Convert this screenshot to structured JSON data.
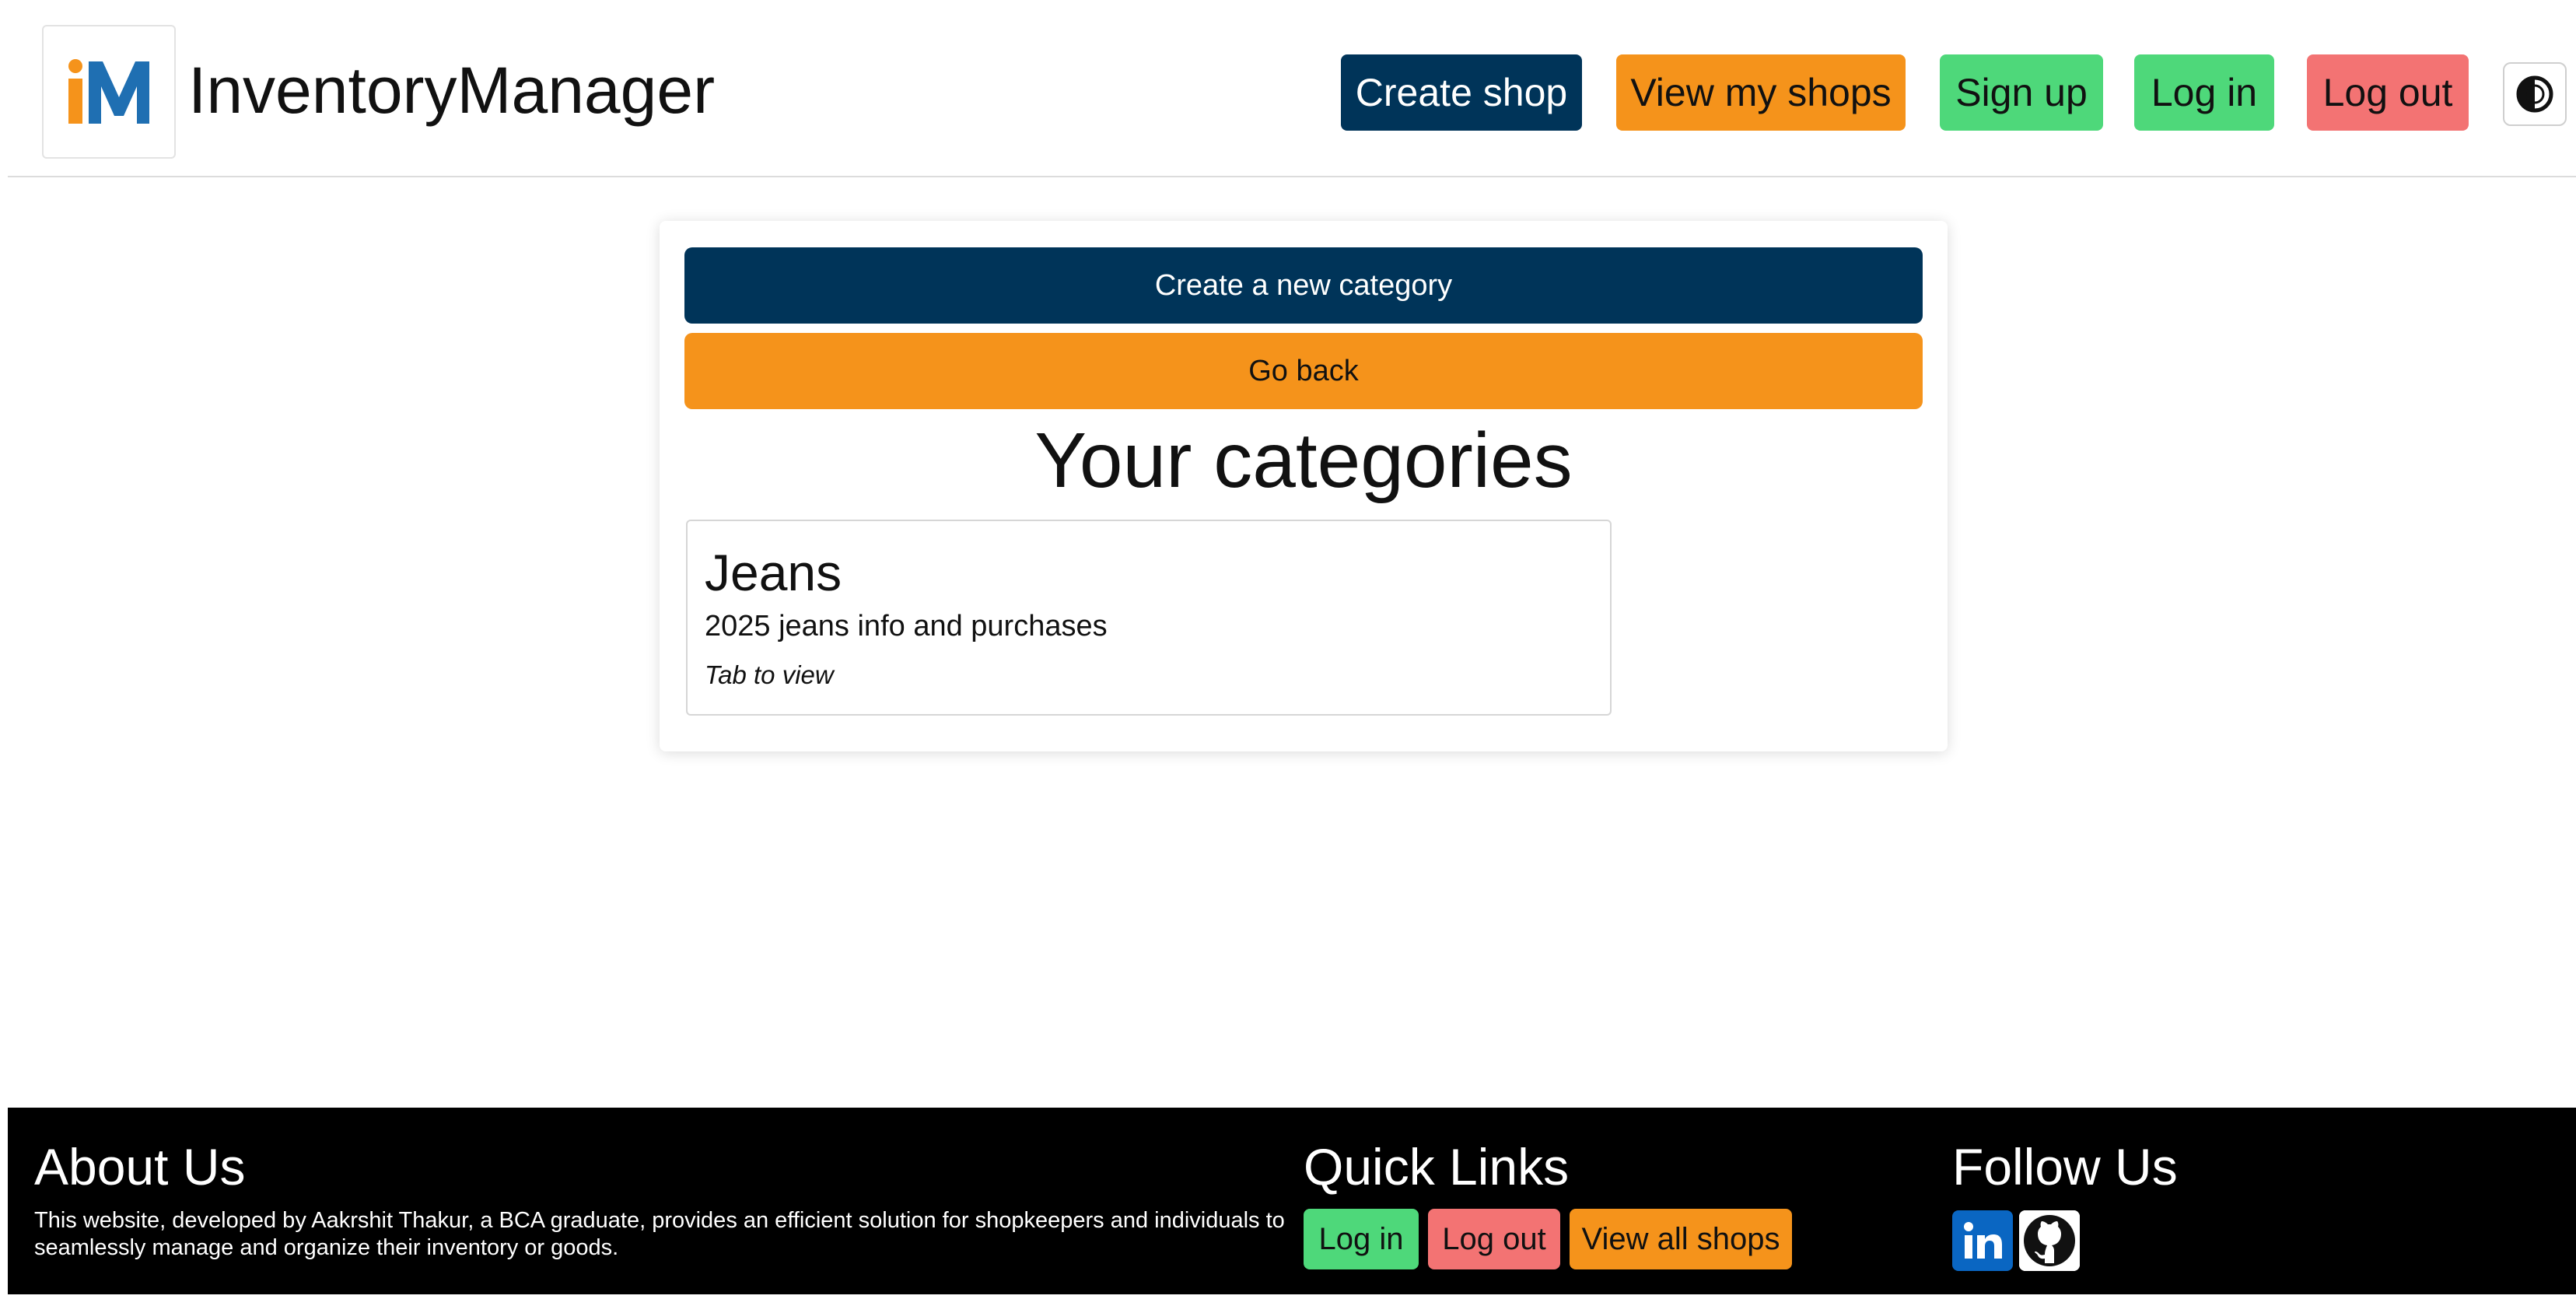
{
  "header": {
    "brand": "InventoryManager",
    "nav": {
      "create_shop": "Create shop",
      "view_my_shops": "View my shops",
      "sign_up": "Sign up",
      "log_in": "Log in",
      "log_out": "Log out"
    }
  },
  "main": {
    "create_category_label": "Create a new category",
    "go_back_label": "Go back",
    "title": "Your categories",
    "categories": [
      {
        "name": "Jeans",
        "description": "2025 jeans info and purchases",
        "hint": "Tab to view"
      }
    ]
  },
  "footer": {
    "about": {
      "heading": "About Us",
      "text": "This website, developed by Aakrshit Thakur, a BCA graduate, provides an efficient solution for shopkeepers and individuals to seamlessly manage and organize their inventory or goods."
    },
    "quick_links": {
      "heading": "Quick Links",
      "log_in": "Log in",
      "log_out": "Log out",
      "view_all_shops": "View all shops"
    },
    "follow": {
      "heading": "Follow Us",
      "icons": [
        "linkedin-icon",
        "github-icon"
      ]
    }
  },
  "colors": {
    "navy": "#003459",
    "orange": "#f5931b",
    "green": "#4ed87a",
    "red": "#f37373",
    "footer_bg": "#000000",
    "linkedin": "#0a66c2"
  },
  "icons": {
    "logo": "im-logo-icon",
    "theme_toggle": "contrast-icon"
  }
}
